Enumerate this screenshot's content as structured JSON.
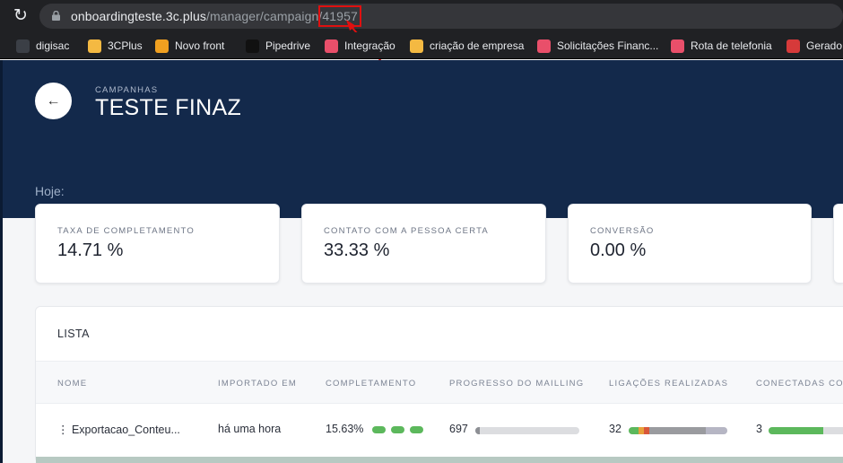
{
  "browser": {
    "url_host": "onboardingteste.3c.plus",
    "url_path": "/manager/campaign/",
    "url_id": "41957"
  },
  "bookmarks": [
    {
      "label": "digisac",
      "color": "#3b3f46"
    },
    {
      "label": "3CPlus",
      "color": "#f4b942"
    },
    {
      "label": "Novo front",
      "color": "#f0a020"
    },
    {
      "label": "Pipedrive",
      "color": "#111111"
    },
    {
      "label": "Integração",
      "color": "#e94f6a"
    },
    {
      "label": "criação de empresa",
      "color": "#f4b942"
    },
    {
      "label": "Solicitações Financ...",
      "color": "#e94f6a"
    },
    {
      "label": "Rota de telefonia",
      "color": "#e94f6a"
    },
    {
      "label": "Gerado",
      "color": "#d63a3a"
    }
  ],
  "header": {
    "breadcrumb": "CAMPANHAS",
    "title": "TESTE FINAZ",
    "today_label": "Hoje:"
  },
  "stats": [
    {
      "label": "TAXA DE COMPLETAMENTO",
      "value": "14.71 %"
    },
    {
      "label": "CONTATO COM A PESSOA CERTA",
      "value": "33.33 %"
    },
    {
      "label": "CONVERSÃO",
      "value": "0.00 %"
    }
  ],
  "list": {
    "title": "LISTA",
    "columns": [
      "NOME",
      "IMPORTADO EM",
      "COMPLETAMENTO",
      "PROGRESSO DO MAILLING",
      "LIGAÇÕES REALIZADAS",
      "CONECTADAS CO"
    ],
    "rows": [
      {
        "name": "⋮ Exportacao_Conteu...",
        "imported": "há uma hora",
        "completion": "15.63%",
        "mailing_count": "697",
        "mailing_progress": 0.04,
        "calls": "32",
        "connected": "3",
        "connected_progress": 0.55
      }
    ]
  }
}
